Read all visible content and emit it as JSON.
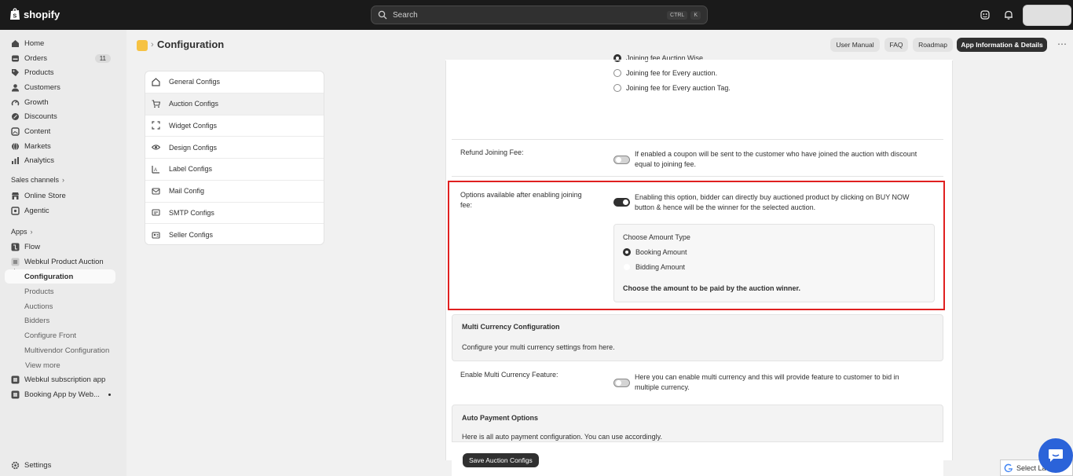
{
  "topbar": {
    "brand": "shopify",
    "search_placeholder": "Search",
    "shortcut_ctrl": "CTRL",
    "shortcut_key": "K"
  },
  "sidebar": {
    "items": [
      {
        "label": "Home",
        "icon": "home-icon"
      },
      {
        "label": "Orders",
        "icon": "orders-icon",
        "badge": "11"
      },
      {
        "label": "Products",
        "icon": "tag-icon"
      },
      {
        "label": "Customers",
        "icon": "person-icon"
      },
      {
        "label": "Growth",
        "icon": "growth-icon"
      },
      {
        "label": "Discounts",
        "icon": "discount-icon"
      },
      {
        "label": "Content",
        "icon": "content-icon"
      },
      {
        "label": "Markets",
        "icon": "globe-icon"
      },
      {
        "label": "Analytics",
        "icon": "analytics-icon"
      }
    ],
    "sales_channels_label": "Sales channels",
    "sales_channels": [
      {
        "label": "Online Store",
        "icon": "store-icon"
      },
      {
        "label": "Agentic",
        "icon": "agentic-icon"
      }
    ],
    "apps_label": "Apps",
    "apps": [
      {
        "label": "Flow",
        "icon": "flow-icon"
      },
      {
        "label": "Webkul Product Auction",
        "icon": "app-icon"
      }
    ],
    "app_sub": [
      "Configuration",
      "Products",
      "Auctions",
      "Bidders",
      "Configure Front",
      "Multivendor Configuration"
    ],
    "view_more": "View more",
    "other_apps": [
      {
        "label": "Webkul subscription app",
        "icon": "app-icon"
      },
      {
        "label": "Booking App by Web...",
        "icon": "app-icon"
      }
    ],
    "settings": "Settings"
  },
  "header": {
    "title": "Configuration",
    "buttons": [
      "User Manual",
      "FAQ",
      "Roadmap"
    ],
    "primary_button": "App Information & Details",
    "more": "⋯"
  },
  "config_nav": [
    {
      "label": "General Configs",
      "icon": "home-icon"
    },
    {
      "label": "Auction Configs",
      "icon": "cart-icon"
    },
    {
      "label": "Widget Configs",
      "icon": "widget-icon"
    },
    {
      "label": "Design Configs",
      "icon": "eye-icon"
    },
    {
      "label": "Label Configs",
      "icon": "label-icon"
    },
    {
      "label": "Mail Config",
      "icon": "mail-icon"
    },
    {
      "label": "SMTP Configs",
      "icon": "smtp-icon"
    },
    {
      "label": "Seller Configs",
      "icon": "seller-icon"
    }
  ],
  "joining_fee": {
    "options": [
      "Joining fee Auction Wise.",
      "Joining fee for Every auction.",
      "Joining fee for Every auction Tag."
    ]
  },
  "refund": {
    "label": "Refund Joining Fee:",
    "desc_line1": "If enabled a coupon will be sent to the customer who have joined the auction with discount",
    "desc_line2": "equal to joining fee."
  },
  "options_after": {
    "label_line1": "Options available after enabling joining",
    "label_line2": "fee:",
    "desc_line1": "Enabling this option, bidder can directly buy auctioned product by clicking on BUY NOW",
    "desc_line2": "button & hence will be the winner for the selected auction.",
    "amount_title": "Choose Amount Type",
    "amount_options": [
      "Booking Amount",
      "Bidding Amount"
    ],
    "amount_note": "Choose the amount to be paid by the auction winner."
  },
  "multi_currency": {
    "title": "Multi Currency Configuration",
    "desc": "Configure your multi currency settings from here.",
    "enable_label": "Enable Multi Currency Feature:",
    "enable_desc_line1": "Here you can enable multi currency and this will provide feature to customer to bid in",
    "enable_desc_line2": "multiple currency."
  },
  "auto_payment": {
    "title": "Auto Payment Options",
    "desc": "Here is all auto payment configuration. You can use accordingly."
  },
  "save_button": "Save Auction Configs",
  "translate": "Select La"
}
